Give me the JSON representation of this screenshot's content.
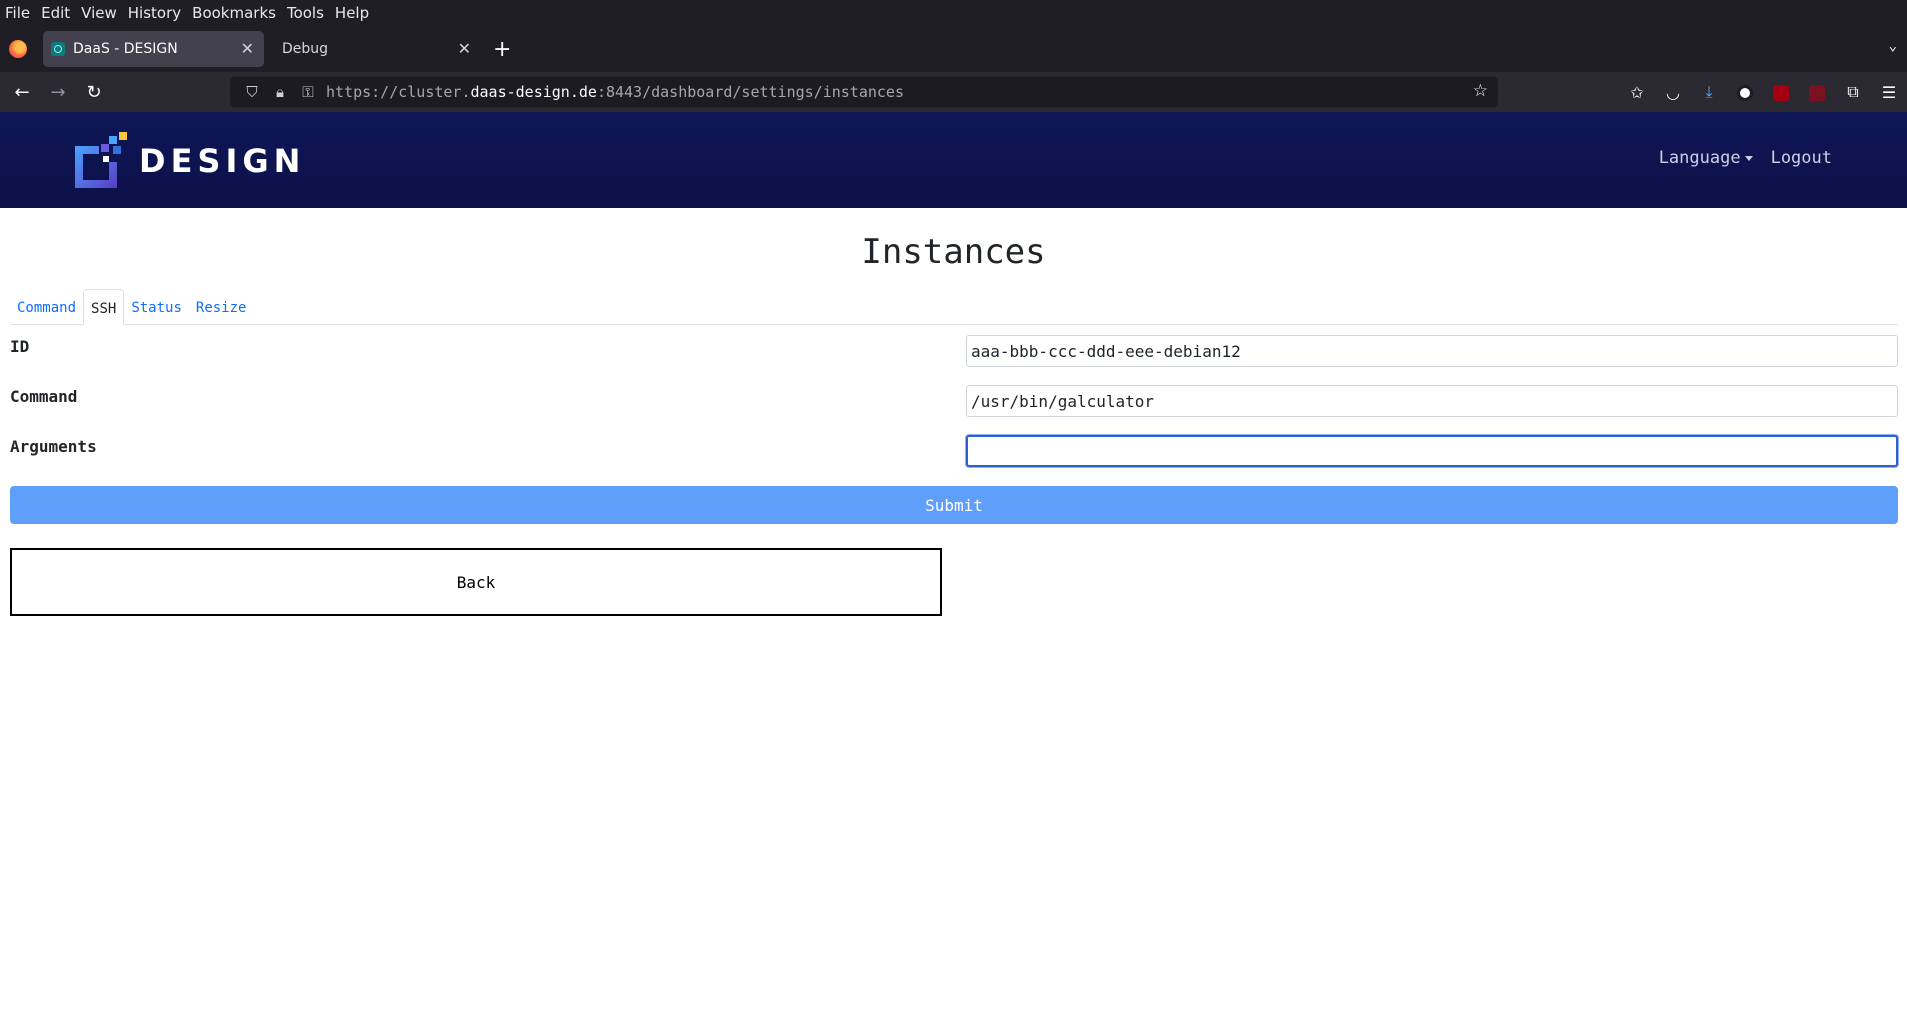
{
  "browser": {
    "menu": [
      "File",
      "Edit",
      "View",
      "History",
      "Bookmarks",
      "Tools",
      "Help"
    ],
    "tabs": [
      {
        "title": "DaaS - DESIGN",
        "active": true
      },
      {
        "title": "Debug",
        "active": false
      }
    ],
    "url": {
      "prefix": "https://cluster.",
      "domain": "daas-design.de",
      "suffix": ":8443/dashboard/settings/instances"
    }
  },
  "header": {
    "brand": "DESIGN",
    "language_label": "Language",
    "logout_label": "Logout"
  },
  "page": {
    "title": "Instances",
    "tabs": [
      {
        "label": "Command",
        "active": false
      },
      {
        "label": "SSH",
        "active": true
      },
      {
        "label": "Status",
        "active": false
      },
      {
        "label": "Resize",
        "active": false
      }
    ],
    "form": {
      "id_label": "ID",
      "id_value": "aaa-bbb-ccc-ddd-eee-debian12",
      "command_label": "Command",
      "command_value": "/usr/bin/galculator",
      "arguments_label": "Arguments",
      "arguments_value": ""
    },
    "submit_label": "Submit",
    "back_label": "Back"
  },
  "colors": {
    "navbar": "#0f1656",
    "submit": "#609ff9",
    "link": "#0d6efd"
  }
}
